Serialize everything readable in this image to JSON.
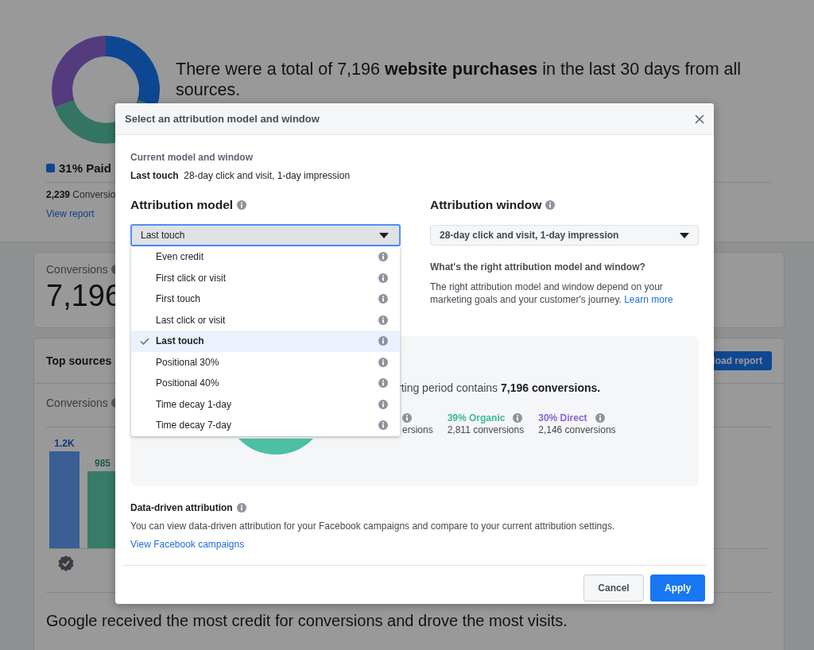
{
  "background": {
    "summary": {
      "headline": "There were a total of 7,196 **website purchases** in the last 30 days from all sources.",
      "legend_label": "31% Paid",
      "conversions": "**2,239** Conversio",
      "link": "View report"
    },
    "conversions_card": {
      "label": "Conversions",
      "value": "7,196"
    },
    "top_sources_card": {
      "title": "Top sources",
      "button": "load report",
      "chart_label": "Conversions",
      "bar_labels": [
        "1.2K",
        "985"
      ],
      "summary": "Google received the most credit for conversions and drove the most visits."
    }
  },
  "dialog": {
    "title": "Select an attribution model and window",
    "current_label": "Current model and window",
    "current_value": "**Last touch**  28-day click and visit, 1-day impression",
    "model": {
      "label": "Attribution model",
      "value": "Last touch",
      "expanded": true,
      "options": [
        {
          "label": "Even credit",
          "selected": false
        },
        {
          "label": "First click or visit",
          "selected": false
        },
        {
          "label": "First touch",
          "selected": false
        },
        {
          "label": "Last click or visit",
          "selected": false
        },
        {
          "label": "Last touch",
          "selected": true
        },
        {
          "label": "Positional 30%",
          "selected": false
        },
        {
          "label": "Positional 40%",
          "selected": false
        },
        {
          "label": "Time decay 1-day",
          "selected": false
        },
        {
          "label": "Time decay 7-day",
          "selected": false
        }
      ]
    },
    "window": {
      "label": "Attribution window",
      "value": "28-day click and visit, 1-day impression"
    },
    "help": {
      "title": "What's the right attribution model and window?",
      "text": "The right attribution model and window depend on your marketing goals and your customer's journey.",
      "link": "Learn more"
    },
    "preview": {
      "text": "rting period contains **7,196 conversions.**",
      "legend": [
        {
          "detail": "ersions"
        },
        {
          "label": "39% Organic",
          "detail": "2,811 conversions",
          "color": "#3fb896"
        },
        {
          "label": "30% Direct",
          "detail": "2,146 conversions",
          "color": "#8a63d2"
        }
      ]
    },
    "data_driven": {
      "title": "Data-driven attribution",
      "text": "You can view data-driven attribution for your Facebook campaigns and compare to your current attribution settings.",
      "link": "View Facebook campaigns"
    },
    "buttons": [
      {
        "label": "Cancel",
        "kind": "secondary"
      },
      {
        "label": "Apply",
        "kind": "primary"
      }
    ]
  }
}
